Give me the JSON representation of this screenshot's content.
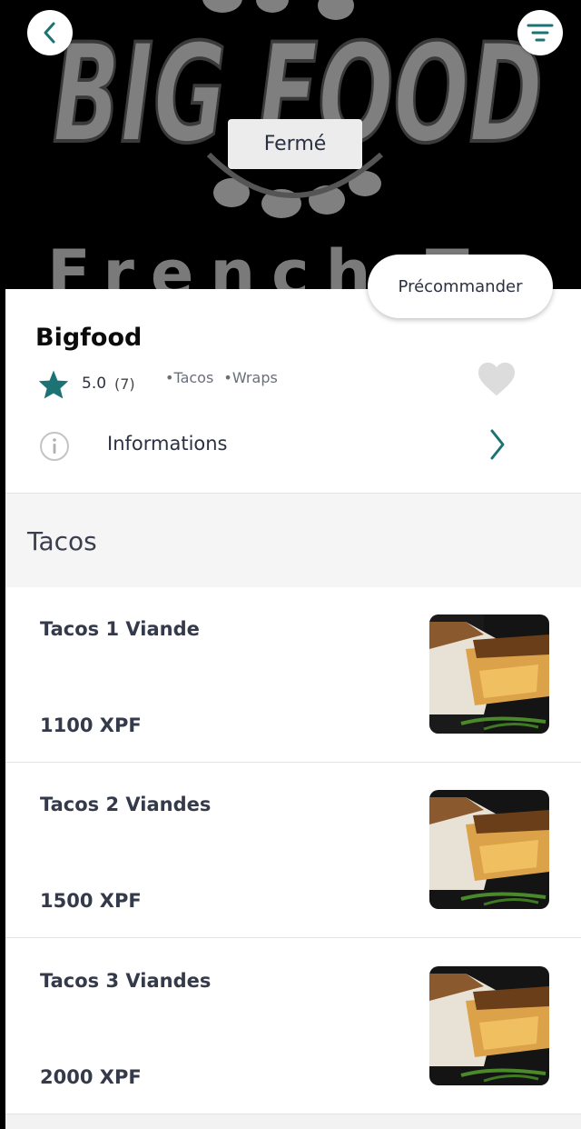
{
  "hero": {
    "logo_text": "BIG FOOD",
    "logo_subtitle": "French T",
    "status_badge": "Fermé"
  },
  "actions": {
    "preorder_label": "Précommander"
  },
  "restaurant": {
    "name": "Bigfood",
    "rating": "5.0",
    "rating_count": "(7)",
    "tags": [
      "•Tacos",
      "•Wraps"
    ],
    "info_label": "Informations"
  },
  "menu": {
    "section_title": "Tacos",
    "items": [
      {
        "name": "Tacos 1 Viande",
        "price": "1100 XPF"
      },
      {
        "name": "Tacos 2 Viandes",
        "price": "1500 XPF"
      },
      {
        "name": "Tacos 3 Viandes",
        "price": "2000 XPF"
      }
    ]
  },
  "colors": {
    "accent": "#1d7373",
    "text_dark": "#2c3142",
    "section_bg": "#f5f5f5",
    "heart_gray": "#dcdcdc"
  },
  "icons": [
    "chevron-left-icon",
    "filter-icon",
    "star-icon",
    "heart-icon",
    "info-icon",
    "chevron-right-icon"
  ]
}
